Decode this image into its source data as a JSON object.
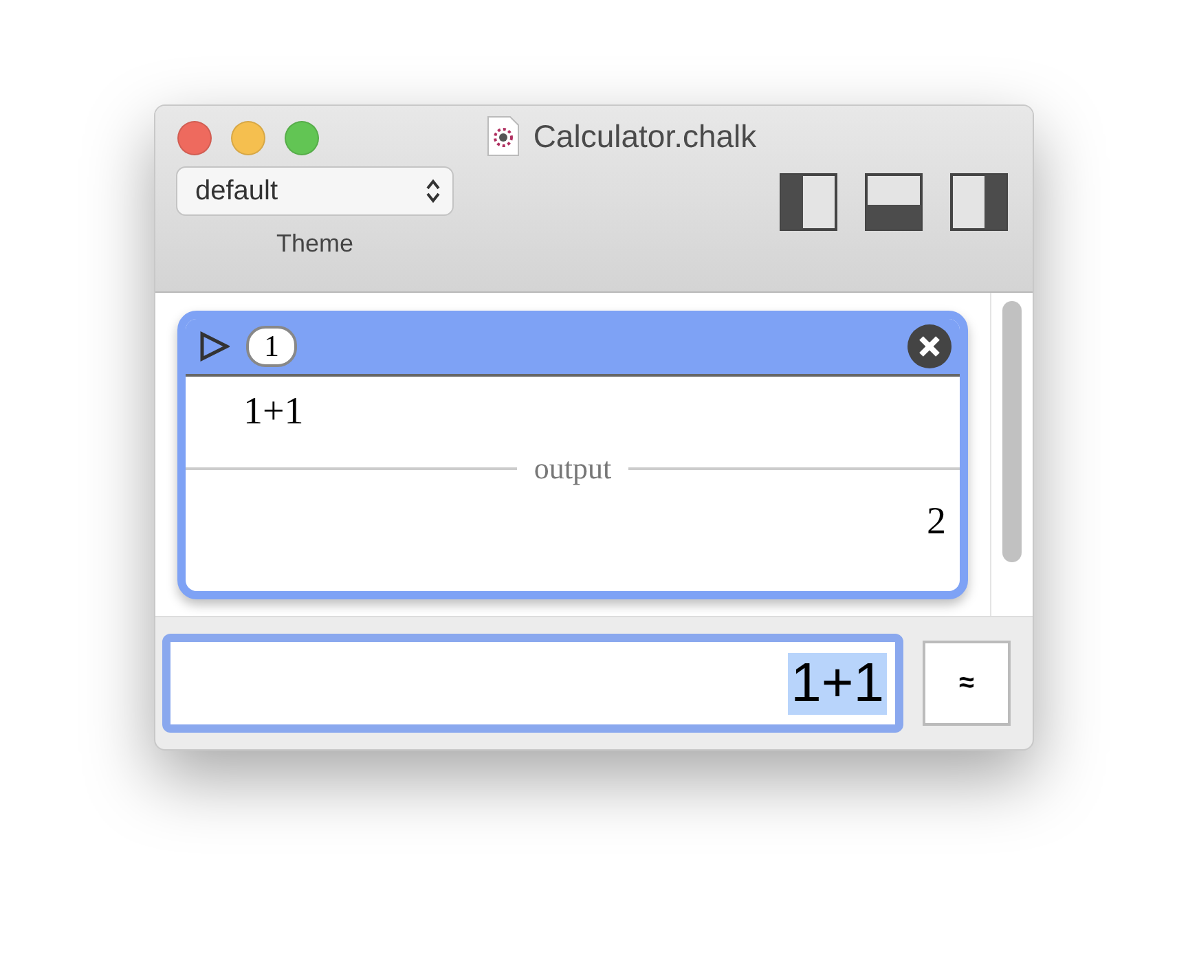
{
  "window": {
    "title": "Calculator.chalk"
  },
  "toolbar": {
    "theme_select": {
      "value": "default"
    },
    "theme_label": "Theme"
  },
  "cells": [
    {
      "index": "1",
      "input": "1+1",
      "separator": "output",
      "output": "2"
    }
  ],
  "entry": {
    "value": "1+1",
    "highlighted": true
  },
  "approx_button": {
    "label": "≈"
  }
}
